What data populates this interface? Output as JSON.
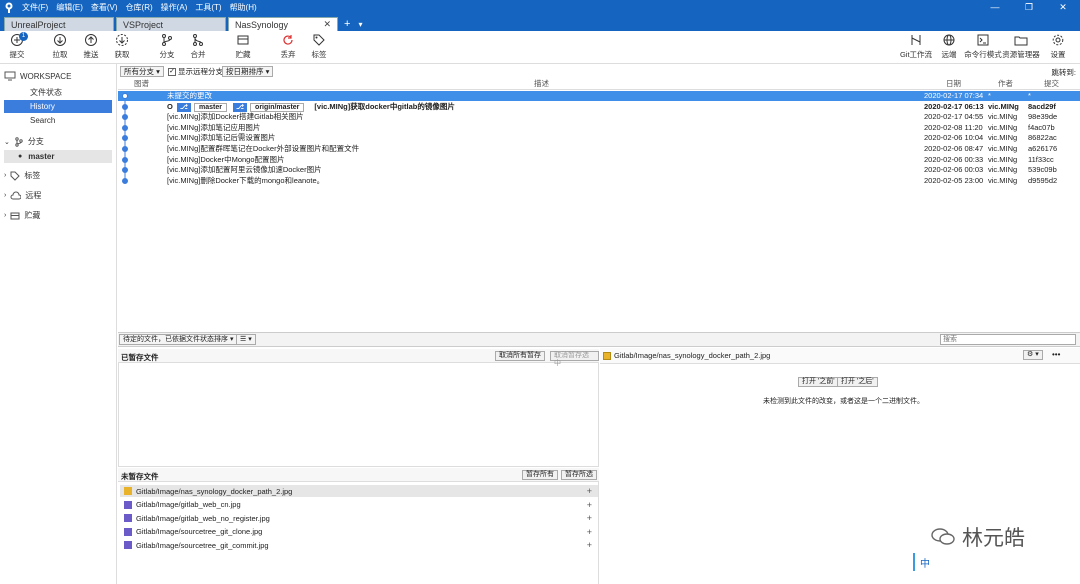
{
  "titlebar": {
    "menu": [
      "文件(F)",
      "编辑(E)",
      "查看(V)",
      "仓库(R)",
      "操作(A)",
      "工具(T)",
      "帮助(H)"
    ],
    "controls": [
      "—",
      "❐",
      "✕"
    ]
  },
  "tabs": [
    {
      "label": "UnrealProject",
      "active": false
    },
    {
      "label": "VSProject",
      "active": false
    },
    {
      "label": "NasSynology",
      "active": true,
      "close": "✕"
    }
  ],
  "tab_add": "+",
  "tab_menu": "▾",
  "toolbar": {
    "commit": {
      "label": "提交",
      "badge": "1"
    },
    "pull": "拉取",
    "push": "推送",
    "fetch": "获取",
    "branch": "分支",
    "merge": "合并",
    "stash": "贮藏",
    "discard": "丢弃",
    "tag": "标签",
    "git_flow": "Git工作流",
    "remote": "远端",
    "terminal": "命令行模式",
    "explorer": "资源管理器",
    "settings": "设置"
  },
  "sidebar": {
    "workspace": "WORKSPACE",
    "file_status": "文件状态",
    "history": "History",
    "search": "Search",
    "branches": "分支",
    "master": "master",
    "tags": "标签",
    "remotes": "远程",
    "stashes": "贮藏"
  },
  "filters": {
    "branch_select": "所有分支 ▾",
    "show_remote": "显示远程分支",
    "sort": "按日期排序 ▾",
    "jump": "跳转到:"
  },
  "columns": {
    "graph": "图谱",
    "desc": "描述",
    "date": "日期",
    "author": "作者",
    "hash": "提交"
  },
  "commits": [
    {
      "desc": "未提交的更改",
      "date": "2020-02-17 07:34",
      "author": "*",
      "hash": "*",
      "selected": true
    },
    {
      "ref_local": "master",
      "ref_remote": "origin/master",
      "desc": "[vic.MINg]获取docker中gitlab的镜像图片",
      "date": "2020-02-17 06:13",
      "author": "vic.MINg",
      "hash": "8acd29f",
      "bold": true
    },
    {
      "desc": "[vic.MINg]添加Docker搭建Gitlab相关图片",
      "date": "2020-02-17 04:55",
      "author": "vic.MINg",
      "hash": "98e39de"
    },
    {
      "desc": "[vic.MINg]添加笔记应用图片",
      "date": "2020-02-08 11:20",
      "author": "vic.MINg",
      "hash": "f4ac07b"
    },
    {
      "desc": "[vic.MINg]添加笔记后需设置图片",
      "date": "2020-02-06 10:04",
      "author": "vic.MINg",
      "hash": "86822ac"
    },
    {
      "desc": "[vic.MINg]配置群晖笔记在Docker外部设置图片和配置文件",
      "date": "2020-02-06 08:47",
      "author": "vic.MINg",
      "hash": "a626176"
    },
    {
      "desc": "[vic.MINg]Docker中Mongo配置图片",
      "date": "2020-02-06 00:33",
      "author": "vic.MINg",
      "hash": "11f33cc"
    },
    {
      "desc": "[vic.MINg]添加配置阿里云镜像加速Docker图片",
      "date": "2020-02-06 00:03",
      "author": "vic.MINg",
      "hash": "539c09b"
    },
    {
      "desc": "[vic.MINg]删除Docker下载的mongo和leanote。",
      "date": "2020-02-05 23:00",
      "author": "vic.MINg",
      "hash": "d9595d2"
    }
  ],
  "lower": {
    "pending_filter": "待定的文件，已依据文件状态排序 ▾",
    "list_mode": "☰ ▾",
    "search_placeholder": "搜索",
    "staged_title": "已暂存文件",
    "unstage_all": "取消所有暂存",
    "unstage_selected": "取消暂存选中",
    "unstaged_title": "未暂存文件",
    "stage_all": "暂存所有",
    "stage_selected": "暂存所选",
    "preview_file": "Gitlab/Image/nas_synology_docker_path_2.jpg",
    "open_before": "打开 '之前'",
    "open_after": "打开 '之后'",
    "no_diff": "未检测到此文件的改变，或者这是一个二进制文件。",
    "more": "•••",
    "gear": "⚙ ▾"
  },
  "unstaged_files": [
    {
      "name": "Gitlab/Image/nas_synology_docker_path_2.jpg",
      "status": "modified"
    },
    {
      "name": "Gitlab/Image/gitlab_web_cn.jpg",
      "status": "untracked"
    },
    {
      "name": "Gitlab/Image/gitlab_web_no_register.jpg",
      "status": "untracked"
    },
    {
      "name": "Gitlab/Image/sourcetree_git_clone.jpg",
      "status": "untracked"
    },
    {
      "name": "Gitlab/Image/sourcetree_git_commit.jpg",
      "status": "untracked"
    }
  ],
  "watermark": "林元皓",
  "ime": "中",
  "colors": {
    "accent": "#1565c0",
    "selection": "#3f8ee8",
    "modified": "#e8b32a",
    "untracked": "#6b5bc9"
  }
}
